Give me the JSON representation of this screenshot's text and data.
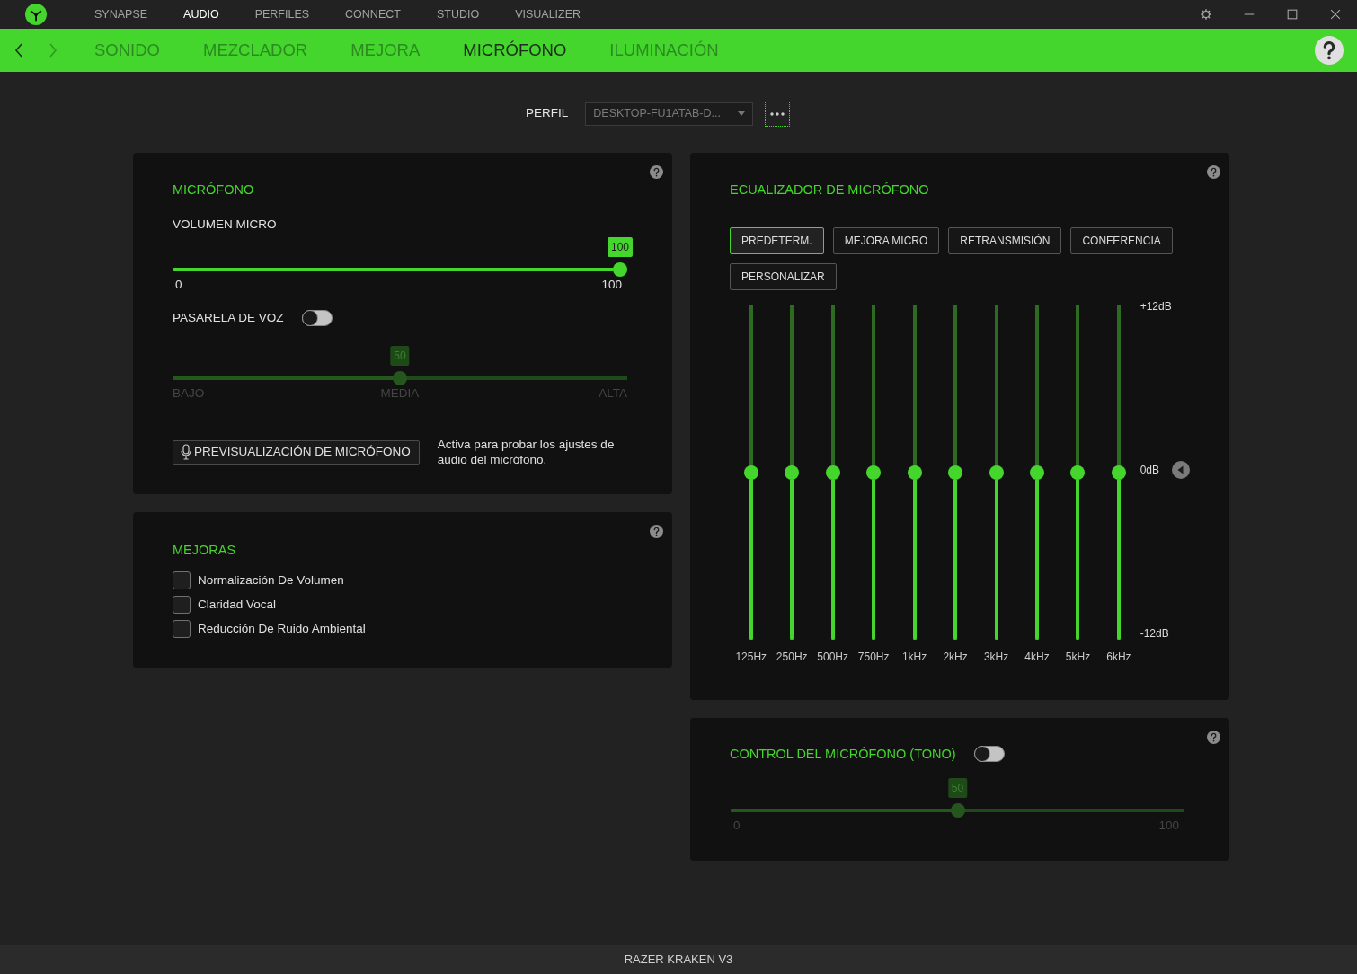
{
  "top_nav": [
    {
      "label": "SYNAPSE",
      "selected": false
    },
    {
      "label": "AUDIO",
      "selected": true
    },
    {
      "label": "PERFILES",
      "selected": false
    },
    {
      "label": "CONNECT",
      "selected": false
    },
    {
      "label": "STUDIO",
      "selected": false
    },
    {
      "label": "VISUALIZER",
      "selected": false
    }
  ],
  "nav_arrows": [
    {
      "kind": "back",
      "disabled": false
    },
    {
      "kind": "forward",
      "disabled": true
    }
  ],
  "section_tabs": [
    {
      "label": "SONIDO",
      "selected": false
    },
    {
      "label": "MEZCLADOR",
      "selected": false
    },
    {
      "label": "MEJORA",
      "selected": false
    },
    {
      "label": "MICRÓFONO",
      "selected": true
    },
    {
      "label": "ILUMINACIÓN",
      "selected": false
    }
  ],
  "profile": {
    "label": "PERFIL",
    "value": "DESKTOP-FU1ATAB-D..."
  },
  "microphone": {
    "title": "MICRÓFONO",
    "volume": {
      "label": "VOLUMEN MICRO",
      "value": "100",
      "level": 1,
      "min_label": "0",
      "max_label": "100"
    },
    "voice_gate": {
      "label": "PASARELA DE VOZ",
      "on": false,
      "value": "50",
      "level": 0.5,
      "scale": [
        "BAJO",
        "MEDIA",
        "ALTA"
      ]
    },
    "preview_button": "PREVISUALIZACIÓN DE MICRÓFONO",
    "preview_hint": "Activa para probar los ajustes de audio del micrófono."
  },
  "enhancements": {
    "title": "MEJORAS",
    "options": [
      {
        "label": "Normalización De Volumen",
        "checked": false
      },
      {
        "label": "Claridad Vocal",
        "checked": false
      },
      {
        "label": "Reducción De Ruido Ambiental",
        "checked": false
      }
    ]
  },
  "equalizer": {
    "title": "ECUALIZADOR DE MICRÓFONO",
    "presets": [
      {
        "label": "PREDETERM.",
        "selected": true
      },
      {
        "label": "MEJORA MICRO",
        "selected": false
      },
      {
        "label": "RETRANSMISIÓN",
        "selected": false
      },
      {
        "label": "CONFERENCIA",
        "selected": false
      },
      {
        "label": "PERSONALIZAR",
        "selected": false
      }
    ],
    "bands": [
      {
        "label": "125Hz",
        "level": 0.5
      },
      {
        "label": "250Hz",
        "level": 0.5
      },
      {
        "label": "500Hz",
        "level": 0.5
      },
      {
        "label": "750Hz",
        "level": 0.5
      },
      {
        "label": "1kHz",
        "level": 0.5
      },
      {
        "label": "2kHz",
        "level": 0.5
      },
      {
        "label": "3kHz",
        "level": 0.5
      },
      {
        "label": "4kHz",
        "level": 0.5
      },
      {
        "label": "5kHz",
        "level": 0.5
      },
      {
        "label": "6kHz",
        "level": 0.5
      }
    ],
    "scale": [
      "+12dB",
      "0dB",
      "-12dB"
    ]
  },
  "sidetone": {
    "title": "CONTROL DEL MICRÓFONO (TONO)",
    "on": false,
    "value": "50",
    "level": 0.5,
    "min_label": "0",
    "max_label": "100"
  },
  "status_bar": {
    "device": "RAZER KRAKEN V3"
  }
}
